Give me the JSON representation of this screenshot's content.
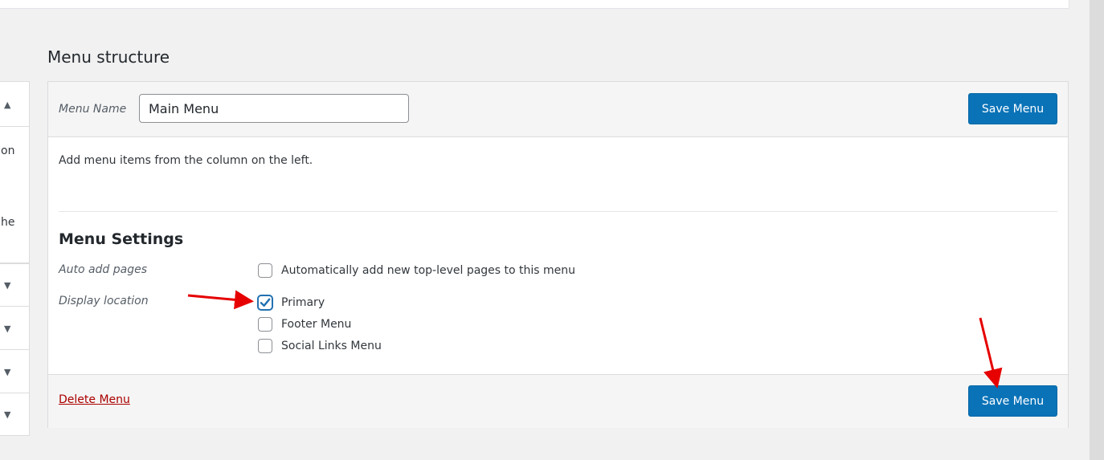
{
  "structure": {
    "heading": "Menu structure",
    "menu_name_label": "Menu Name",
    "menu_name_value": "Main Menu",
    "save_label": "Save Menu",
    "instruction": "Add menu items from the column on the left."
  },
  "settings": {
    "title": "Menu Settings",
    "auto_add_label": "Auto add pages",
    "auto_add_option": "Automatically add new top-level pages to this menu",
    "display_location_label": "Display location",
    "locations": [
      {
        "label": "Primary",
        "checked": true
      },
      {
        "label": "Footer Menu",
        "checked": false
      },
      {
        "label": "Social Links Menu",
        "checked": false
      }
    ]
  },
  "footer": {
    "delete_label": "Delete Menu",
    "save_label": "Save Menu"
  },
  "left_column": {
    "fragment_1": "on",
    "fragment_2": "he"
  },
  "colors": {
    "primary_button": "#0a73b8",
    "delete_link": "#aa0000",
    "annotation_arrow": "#e60000"
  }
}
